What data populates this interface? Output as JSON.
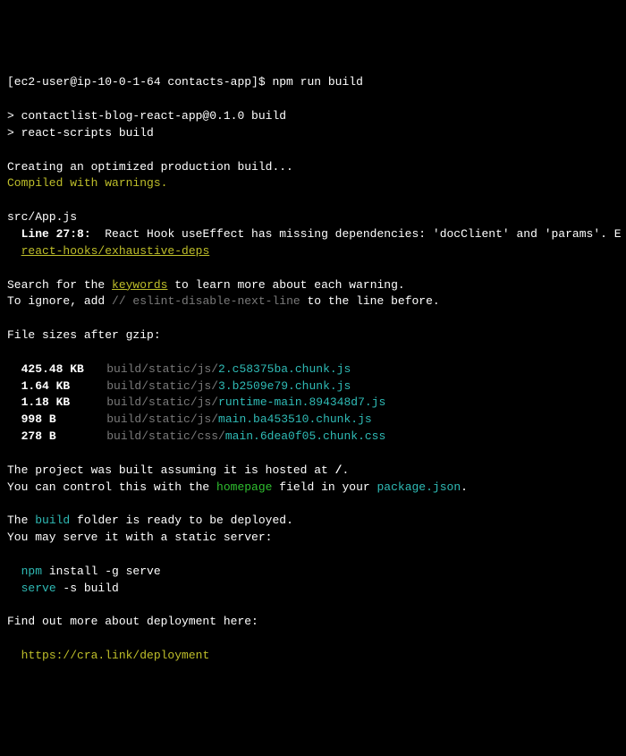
{
  "prompt": {
    "full": "[ec2-user@ip-10-0-1-64 contacts-app]$ npm run build"
  },
  "script": {
    "line1": "> contactlist-blog-react-app@0.1.0 build",
    "line2": "> react-scripts build"
  },
  "creating": "Creating an optimized production build...",
  "compiled": "Compiled with warnings.",
  "warning": {
    "file": "src/App.js",
    "line_prefix": "  Line 27:8:",
    "line_msg": "  React Hook useEffect has missing dependencies: 'docClient' and 'params'. E",
    "rule": "react-hooks/exhaustive-deps"
  },
  "search": {
    "pre": "Search for the ",
    "kw": "keywords",
    "post": " to learn more about each warning."
  },
  "ignore": {
    "pre": "To ignore, add ",
    "comment": "// eslint-disable-next-line",
    "post": " to the line before."
  },
  "sizes_header": "File sizes after gzip:",
  "files": [
    {
      "size": "425.48 KB",
      "path": "build/static/js/",
      "name": "2.c58375ba.chunk.js"
    },
    {
      "size": "1.64 KB",
      "path": "build/static/js/",
      "name": "3.b2509e79.chunk.js"
    },
    {
      "size": "1.18 KB",
      "path": "build/static/js/",
      "name": "runtime-main.894348d7.js"
    },
    {
      "size": "998 B",
      "path": "build/static/js/",
      "name": "main.ba453510.chunk.js"
    },
    {
      "size": "278 B",
      "path": "build/static/css/",
      "name": "main.6dea0f05.chunk.css"
    }
  ],
  "hosted": {
    "pre": "The project was built assuming it is hosted at ",
    "slash": "/",
    "post": "."
  },
  "control": {
    "pre": "You can control this with the ",
    "homepage": "homepage",
    "mid": " field in your ",
    "pkg": "package.json",
    "post": "."
  },
  "ready": {
    "pre": "The ",
    "build": "build",
    "post": " folder is ready to be deployed."
  },
  "serve_hint": "You may serve it with a static server:",
  "cmd1": {
    "a": "npm",
    "b": " install -g serve"
  },
  "cmd2": {
    "a": "serve",
    "b": " -s build"
  },
  "deploy_hint": "Find out more about deployment here:",
  "deploy_link": "https://cra.link/deployment"
}
